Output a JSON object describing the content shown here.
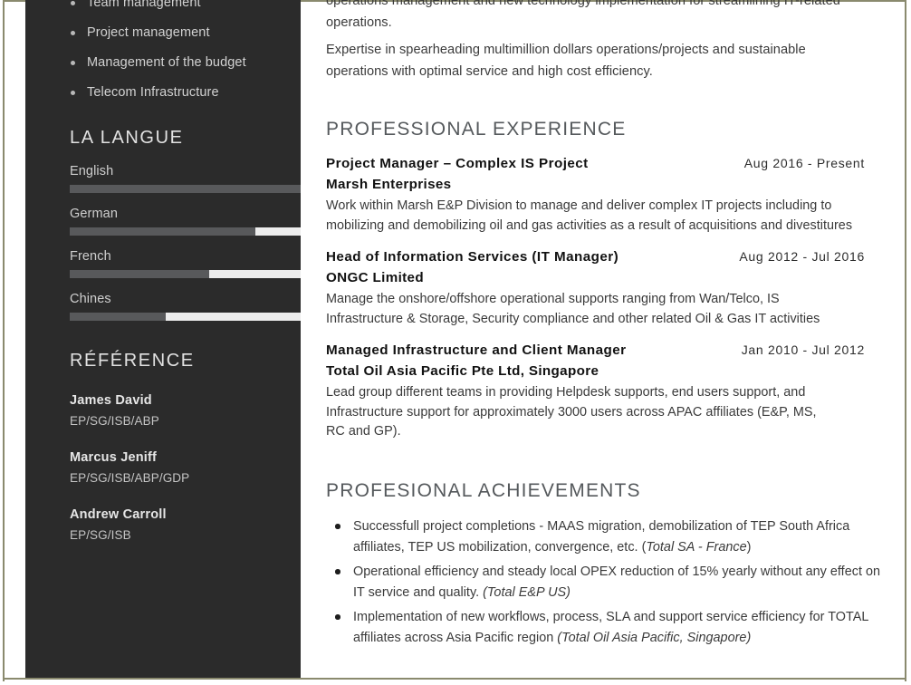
{
  "document": {
    "type": "resume",
    "frame_color": "#8a8a6e",
    "sidebar_bg": "#2b2b2b",
    "accent_text": "#55595c"
  },
  "sidebar": {
    "skills": [
      {
        "label": "Team management"
      },
      {
        "label": "Project management"
      },
      {
        "label": "Management of the budget"
      },
      {
        "label": "Telecom Infrastructure"
      }
    ],
    "languages": {
      "heading": "LA LANGUE",
      "items": [
        {
          "name": "English",
          "level": 100
        },
        {
          "name": "German",
          "level": 77
        },
        {
          "name": "French",
          "level": 58
        },
        {
          "name": "Chines",
          "level": 40
        }
      ]
    },
    "reference": {
      "heading": "RÉFÉRENCE",
      "items": [
        {
          "name": "James David",
          "detail": "EP/SG/ISB/ABP"
        },
        {
          "name": "Marcus Jeniff",
          "detail": "EP/SG/ISB/ABP/GDP"
        },
        {
          "name": "Andrew Carroll",
          "detail": "EP/SG/ISB"
        }
      ]
    }
  },
  "main": {
    "intro": [
      "operations management and new technology implementation for streamlining IT-related operations.",
      "Expertise in spearheading multimillion dollars operations/projects and sustainable operations with optimal service and high cost efficiency."
    ],
    "experience": {
      "heading": "PROFESSIONAL EXPERIENCE",
      "jobs": [
        {
          "title": "Project Manager – Complex IS Project",
          "dates": "Aug 2016 - Present",
          "company": "Marsh Enterprises",
          "description": "Work within Marsh E&P Division to manage and deliver complex IT projects including  to mobilizing and demobilizing oil and gas activities as a result of acquisitions and divestitures"
        },
        {
          "title": "Head of Information Services (IT Manager)",
          "dates": "Aug 2012 - Jul 2016",
          "company": "ONGC Limited",
          "description": "Manage the onshore/offshore operational supports ranging from Wan/Telco, IS Infrastructure & Storage, Security compliance and other related Oil & Gas IT activities"
        },
        {
          "title": "Managed Infrastructure and Client Manager",
          "dates": "Jan 2010 - Jul 2012",
          "company": "Total Oil Asia Pacific Pte Ltd, Singapore",
          "description": "Lead group different teams in providing Helpdesk supports, end users support, and Infrastructure support for approximately 3000 users across APAC affiliates (E&P, MS, RC and GP)."
        }
      ]
    },
    "achievements": {
      "heading": "PROFESIONAL ACHIEVEMENTS",
      "items": [
        {
          "text": "Successfull project completions - MAAS migration, demobilization of TEP South Africa affiliates, TEP US mobilization, convergence, etc. (",
          "emphasis": "Total SA - France",
          "tail": ")"
        },
        {
          "text": "Operational efficiency and steady local OPEX reduction of 15% yearly without any effect on IT service and quality. ",
          "emphasis": "(Total E&P US)",
          "tail": ""
        },
        {
          "text": "Implementation of new workflows, process, SLA and support service efficiency for TOTAL affiliates across Asia Pacific region ",
          "emphasis": "(Total Oil Asia Pacific, Singapore)",
          "tail": ""
        }
      ]
    }
  }
}
